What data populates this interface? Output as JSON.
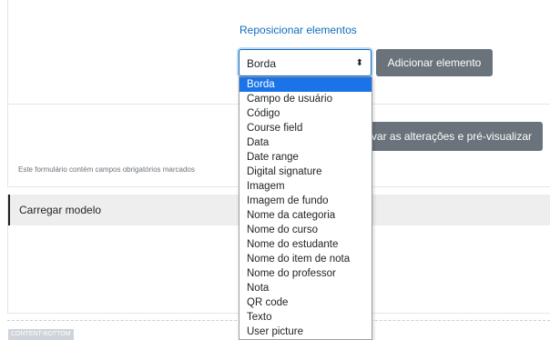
{
  "form": {
    "reposition_label": "Reposicionar elementos",
    "select_value": "Borda",
    "select_arrow": "⬍",
    "add_button_label": "Adicionar elemento",
    "save_button_label": "lvar as alterações e pré-visualizar",
    "required_note": "Este formulário contém campos obrigatórios marcados"
  },
  "dropdown": {
    "selected": "Borda",
    "options": [
      "Borda",
      "Campo de usuário",
      "Código",
      "Course field",
      "Data",
      "Date range",
      "Digital signature",
      "Imagem",
      "Imagem de fundo",
      "Nome da categoria",
      "Nome do curso",
      "Nome do estudante",
      "Nome do item de nota",
      "Nome do professor",
      "Nota",
      "QR code",
      "Texto",
      "User picture"
    ]
  },
  "section": {
    "title": "Carregar modelo"
  },
  "footer": {
    "region_label": "CONTENT-BOTTOM"
  },
  "colors": {
    "link": "#0f6cbf",
    "button": "#6a737b",
    "selected_option": "#1a73e8",
    "section_header": "#eeeeee"
  }
}
